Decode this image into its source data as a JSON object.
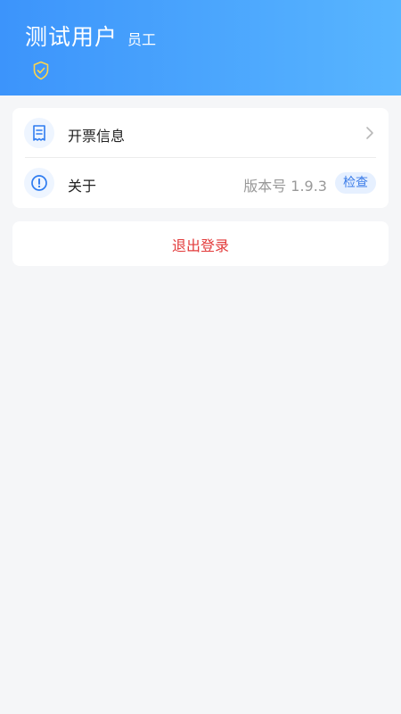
{
  "profile": {
    "name": "测试用户",
    "role": "员工",
    "badge_icon": "shield-check-icon",
    "header_gradient": [
      "#3c94fb",
      "#58b5ff"
    ]
  },
  "menu": {
    "invoice": {
      "label": "开票信息",
      "icon": "receipt-icon"
    },
    "about": {
      "label": "关于",
      "icon": "alert-circle-icon",
      "version": "版本号 1.9.3",
      "check_label": "检查"
    }
  },
  "logout": {
    "label": "退出登录",
    "color": "#e23a3a"
  }
}
